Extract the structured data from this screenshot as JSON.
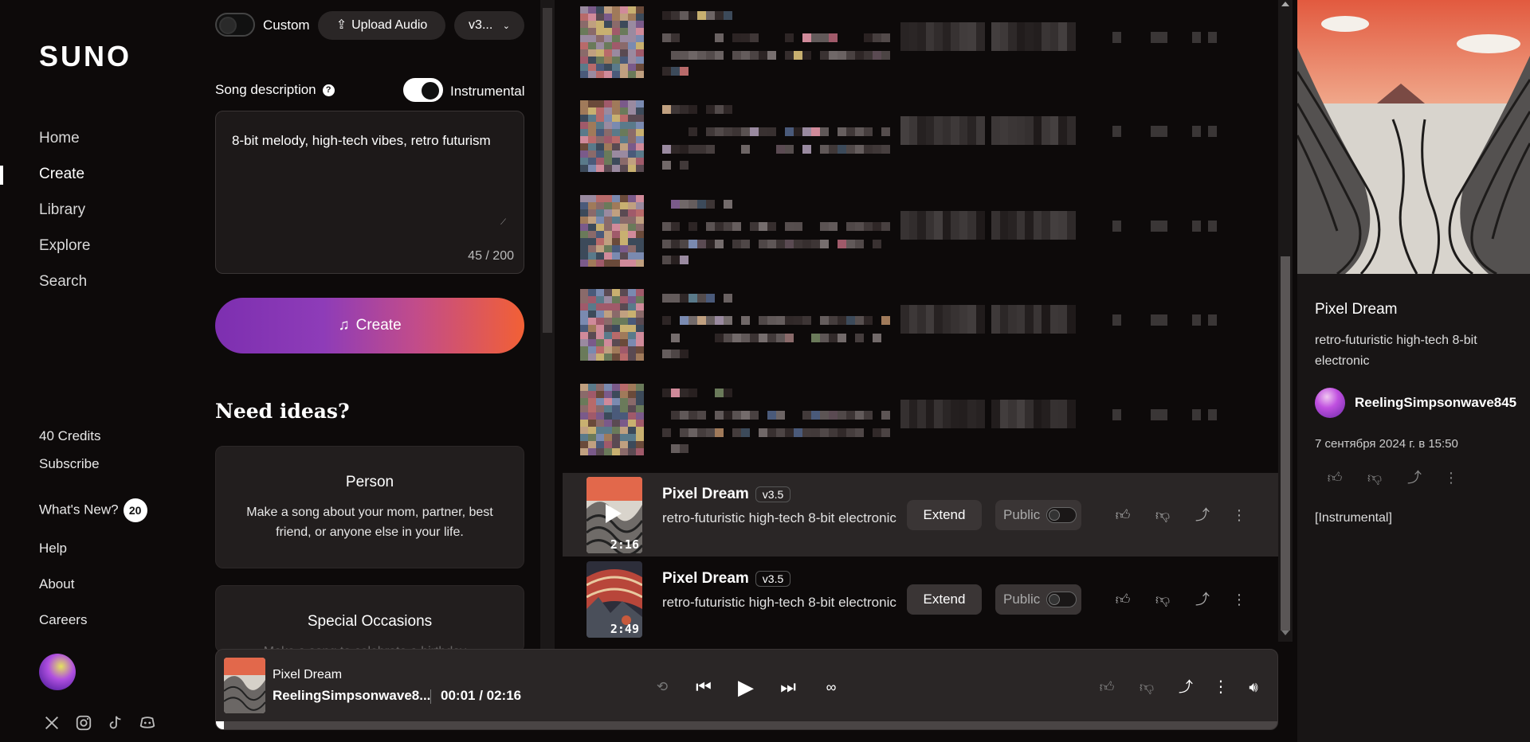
{
  "sidebar": {
    "logo": "SUNO",
    "nav": [
      {
        "label": "Home"
      },
      {
        "label": "Create"
      },
      {
        "label": "Library"
      },
      {
        "label": "Explore"
      },
      {
        "label": "Search"
      }
    ],
    "credits": "40 Credits",
    "subscribe": "Subscribe",
    "whats_new": "What's New?",
    "whats_new_count": "20",
    "help": "Help",
    "about": "About",
    "careers": "Careers",
    "social": [
      "x-icon",
      "instagram-icon",
      "tiktok-icon",
      "discord-icon"
    ]
  },
  "create": {
    "custom_label": "Custom",
    "upload_label": "Upload Audio",
    "version_label": "v3...",
    "description_label": "Song description",
    "instrumental_label": "Instrumental",
    "description_value": "8-bit melody, high-tech vibes, retro futurism",
    "char_count": "45 / 200",
    "create_label": "Create",
    "need_ideas": "Need ideas?",
    "ideas": [
      {
        "title": "Person",
        "body": "Make a song about your mom, partner, best friend, or anyone else in your life."
      },
      {
        "title": "Special Occasions",
        "body": "Make a song to celebrate a birthday..."
      }
    ]
  },
  "songs": [
    {
      "title": "Pixel Dream",
      "version": "v3.5",
      "description": "retro-futuristic high-tech 8-bit electronic",
      "duration": "2:16",
      "extend": "Extend",
      "visibility": "Public"
    },
    {
      "title": "Pixel Dream",
      "version": "v3.5",
      "description": "retro-futuristic high-tech 8-bit electronic",
      "duration": "2:49",
      "extend": "Extend",
      "visibility": "Public"
    }
  ],
  "detail": {
    "title": "Pixel Dream",
    "description": "retro-futuristic high-tech 8-bit electronic",
    "user": "ReelingSimpsonwave845",
    "date": "7 сентября 2024 г. в 15:50",
    "lyrics": "[Instrumental]"
  },
  "player": {
    "title": "Pixel Dream",
    "user": "ReelingSimpsonwave8...",
    "time": "00:01 / 02:16",
    "progress": 0.007
  },
  "colors": {
    "background": "#0d0a0a",
    "panel": "#2a2626",
    "create_gradient_start": "#7d2fb0",
    "create_gradient_end": "#f26035"
  }
}
